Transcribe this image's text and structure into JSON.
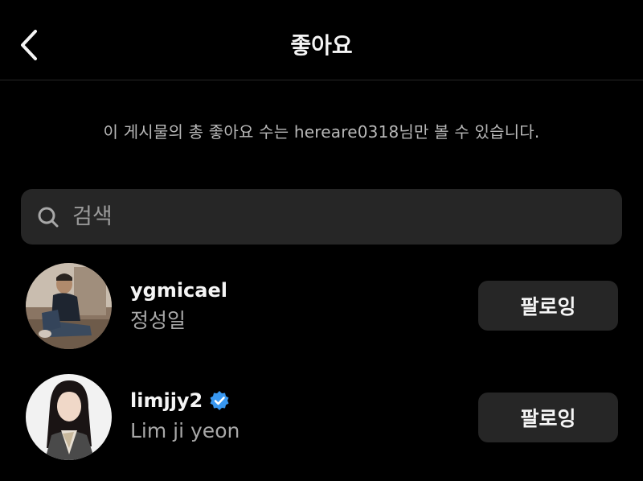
{
  "header": {
    "title": "좋아요"
  },
  "notice": "이 게시물의 총 좋아요 수는 hereare0318님만 볼 수 있습니다.",
  "search": {
    "placeholder": "검색"
  },
  "users": [
    {
      "username": "ygmicael",
      "fullname": "정성일",
      "verified": false,
      "button_label": "팔로잉"
    },
    {
      "username": "limjjy2",
      "fullname": "Lim ji yeon",
      "verified": true,
      "button_label": "팔로잉"
    }
  ],
  "colors": {
    "background": "#000000",
    "surface": "#262626",
    "primary_text": "#f5f5f5",
    "secondary_text": "#a8a8a8",
    "verified_badge": "#3897f0"
  },
  "icons": {
    "back": "chevron-left-icon",
    "search": "search-icon",
    "verified": "verified-badge-icon"
  }
}
